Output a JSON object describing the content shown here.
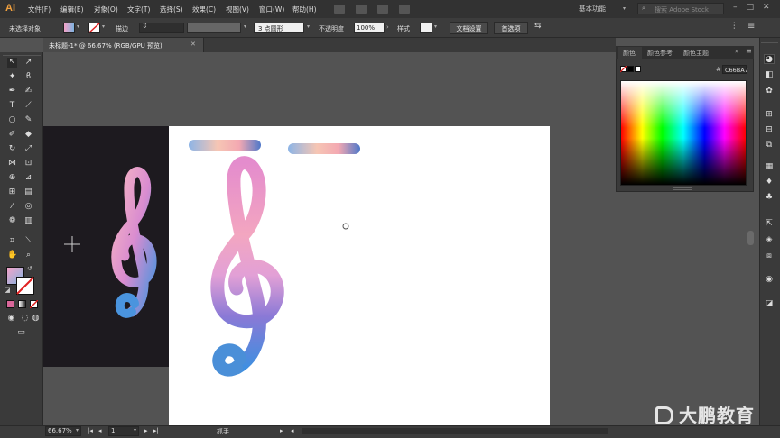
{
  "menubar": {
    "logo": "Ai",
    "items": [
      "文件(F)",
      "编辑(E)",
      "对象(O)",
      "文字(T)",
      "选择(S)",
      "效果(C)",
      "视图(V)",
      "窗口(W)",
      "帮助(H)"
    ],
    "workspace": "基本功能",
    "search_placeholder": "搜索 Adobe Stock"
  },
  "controlbar": {
    "selection_status": "未选择对象",
    "stroke_label": "描边",
    "brush_label": "3 点圆形",
    "opacity_label": "不透明度",
    "opacity_value": "100%",
    "style_label": "样式",
    "doc_setup_button": "文档设置",
    "preferences_button": "首选项"
  },
  "document": {
    "tab_title": "未标题-1* @ 66.67% (RGB/GPU 预览)"
  },
  "color_panel": {
    "tabs": [
      "颜色",
      "颜色参考",
      "颜色主题"
    ],
    "hex_value": "C66BA7"
  },
  "statusbar": {
    "zoom": "66.67%",
    "artboard_num": "1",
    "tool_name": "抓手"
  },
  "watermark": {
    "text": "大鹏教育"
  },
  "colors": {
    "fill_gradient_start": "#f4a3c8",
    "fill_gradient_end": "#7fb4e0",
    "spectrum_hex": "#C66BA7"
  }
}
